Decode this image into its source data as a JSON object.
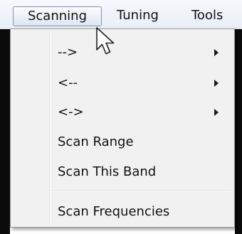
{
  "menubar": {
    "items": [
      {
        "label": "Scanning"
      },
      {
        "label": "Tuning"
      },
      {
        "label": "Tools"
      }
    ]
  },
  "dropdown": {
    "items": [
      {
        "label": "-->",
        "submenu": true
      },
      {
        "label": "<--",
        "submenu": true
      },
      {
        "label": "<->",
        "submenu": true
      },
      {
        "label": "Scan Range",
        "submenu": false
      },
      {
        "label": "Scan This Band",
        "submenu": false
      },
      {
        "label": "Scan Frequencies",
        "submenu": false
      }
    ]
  },
  "cursor": {
    "icon": "mouse-pointer-icon"
  },
  "colors": {
    "menu_background": "#f1f1f1",
    "menubar_background": "#e9eef6",
    "active_border": "#7b93b1"
  }
}
